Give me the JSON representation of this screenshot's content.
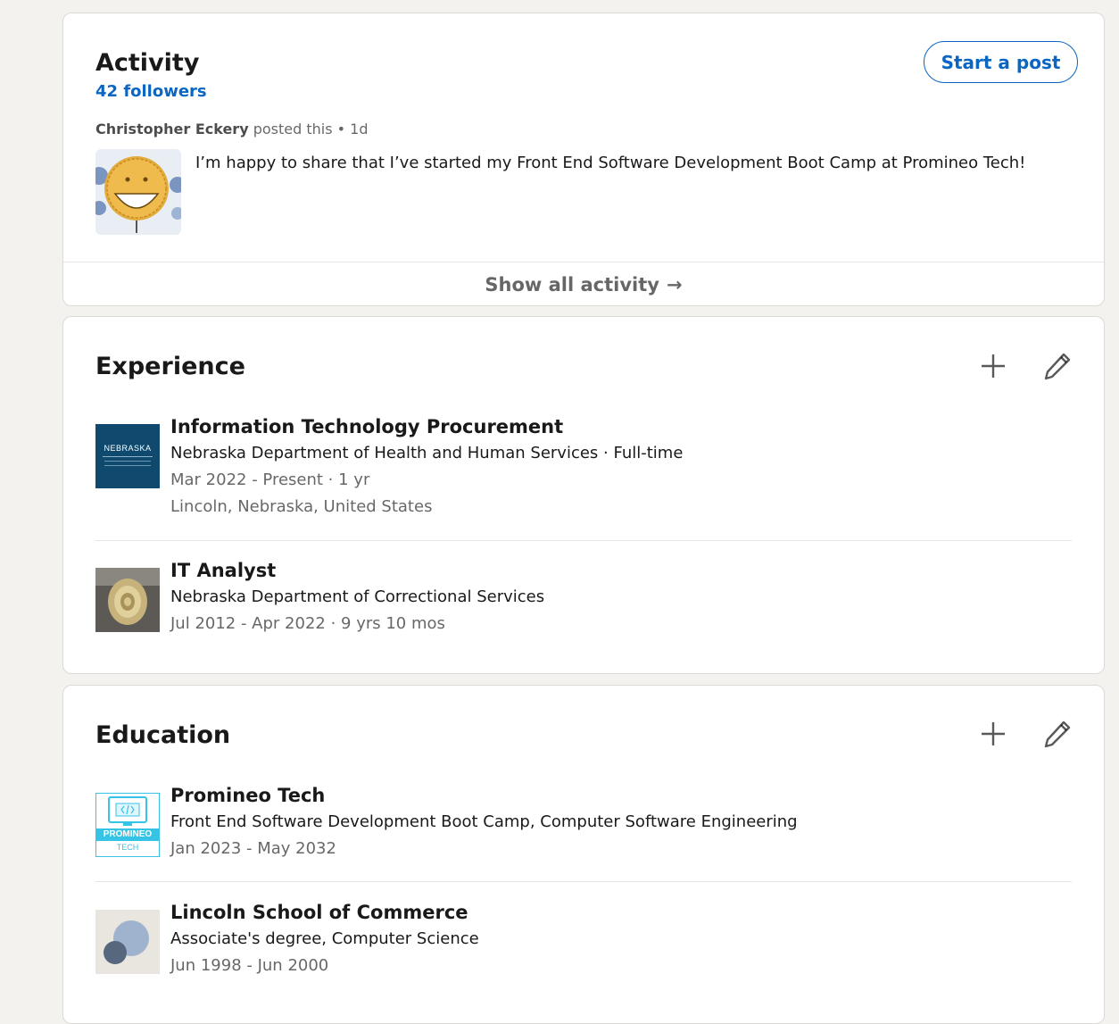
{
  "activity": {
    "title": "Activity",
    "followers": "42 followers",
    "start_post_label": "Start a post",
    "post": {
      "author": "Christopher Eckery",
      "meta_suffix": "posted this • 1d",
      "text": "I’m happy to share that I’ve started my Front End Software Development Boot Camp at Promineo Tech!"
    },
    "show_all_label": "Show all activity",
    "show_all_arrow": "→"
  },
  "experience": {
    "title": "Experience",
    "logo_text": "NEBRASKA",
    "items": [
      {
        "title": "Information Technology Procurement",
        "org": "Nebraska Department of Health and Human Services · Full-time",
        "dates": "Mar 2022 - Present · 1 yr",
        "location": "Lincoln, Nebraska, United States"
      },
      {
        "title": "IT Analyst",
        "org": "Nebraska Department of Correctional Services",
        "dates": "Jul 2012 - Apr 2022 · 9 yrs 10 mos"
      }
    ]
  },
  "education": {
    "title": "Education",
    "logo_text": [
      "PROMINEO",
      "TECH"
    ],
    "items": [
      {
        "school": "Promineo Tech",
        "degree": "Front End Software Development Boot Camp, Computer Software Engineering",
        "dates": "Jan 2023 - May 2032"
      },
      {
        "school": "Lincoln School of Commerce",
        "degree": "Associate's degree, Computer Science",
        "dates": "Jun 1998 - Jun 2000"
      }
    ]
  },
  "colors": {
    "link_blue": "#0a66c2",
    "page_bg": "#f3f2ef",
    "nebraska_logo_bg": "#0f4a6e"
  },
  "icons": {
    "add": "plus-icon",
    "edit": "pencil-icon",
    "arrow": "arrow-right-icon"
  }
}
